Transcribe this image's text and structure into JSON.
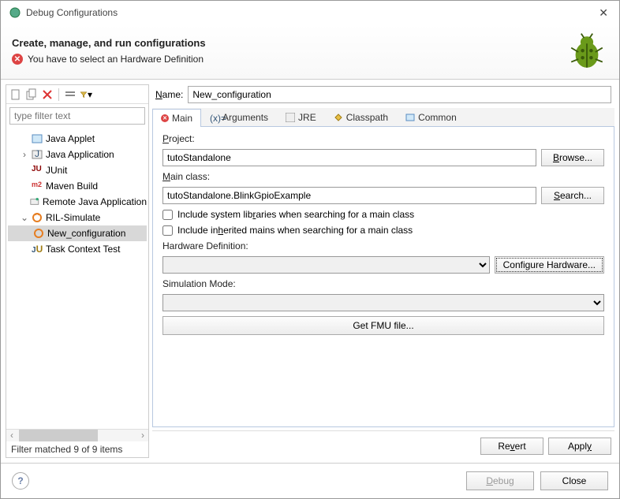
{
  "window": {
    "title": "Debug Configurations"
  },
  "header": {
    "title": "Create, manage, and run configurations",
    "error": "You have to select an Hardware Definition"
  },
  "left": {
    "filter_placeholder": "type filter text",
    "items": [
      {
        "label": "Java Applet",
        "icon": "applet"
      },
      {
        "label": "Java Application",
        "icon": "java",
        "expandable": true
      },
      {
        "label": "JUnit",
        "icon": "junit"
      },
      {
        "label": "Maven Build",
        "icon": "maven"
      },
      {
        "label": "Remote Java Application",
        "icon": "remote"
      },
      {
        "label": "RIL-Simulate",
        "icon": "ril",
        "expanded": true,
        "children": [
          {
            "label": "New_configuration",
            "icon": "ril",
            "selected": true
          }
        ]
      },
      {
        "label": "Task Context Test",
        "icon": "task"
      }
    ],
    "status": "Filter matched 9 of 9 items"
  },
  "name": {
    "label": "Name:",
    "value": "New_configuration"
  },
  "tabs": [
    {
      "label": "Main",
      "active": true,
      "err": true
    },
    {
      "label": "Arguments"
    },
    {
      "label": "JRE"
    },
    {
      "label": "Classpath"
    },
    {
      "label": "Common"
    }
  ],
  "main": {
    "project_label": "Project:",
    "project_value": "tutoStandalone",
    "browse_label": "Browse...",
    "mainclass_label": "Main class:",
    "mainclass_value": "tutoStandalone.BlinkGpioExample",
    "search_label": "Search...",
    "chk1": "Include system libraries when searching for a main class",
    "chk2": "Include inherited mains when searching for a main class",
    "hw_label": "Hardware Definition:",
    "configure_label": "Configure Hardware...",
    "sim_label": "Simulation Mode:",
    "fmu_label": "Get FMU file..."
  },
  "right_footer": {
    "revert": "Revert",
    "apply": "Apply"
  },
  "footer": {
    "debug": "Debug",
    "close": "Close"
  }
}
